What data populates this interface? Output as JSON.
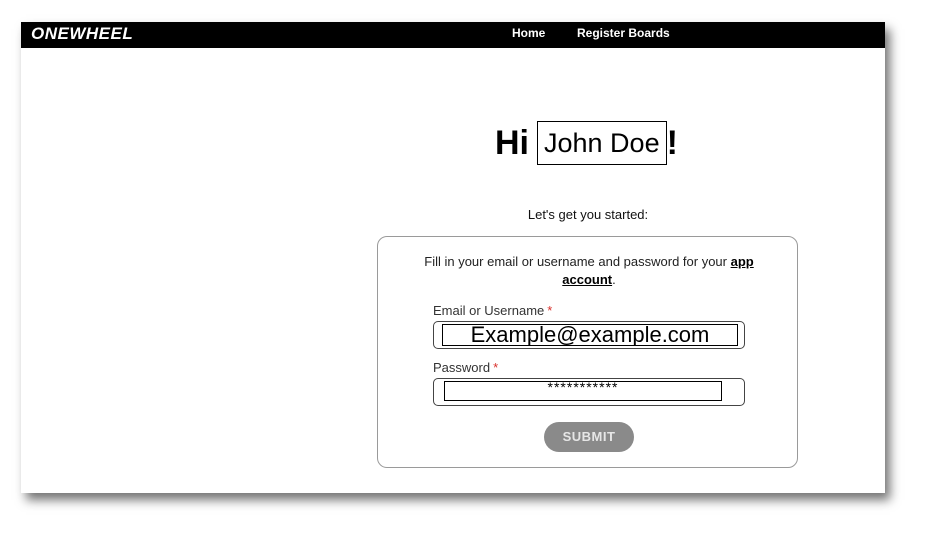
{
  "header": {
    "logo_text": "ONEWHEEL",
    "nav": [
      {
        "label": "Home"
      },
      {
        "label": "Register Boards"
      }
    ]
  },
  "greeting": {
    "prefix": "Hi",
    "name": "John Doe",
    "suffix": "!"
  },
  "subtitle": "Let's get you started:",
  "form": {
    "intro_before": "Fill in your email or username and password for your ",
    "intro_link": "app account",
    "intro_after": ".",
    "email_label": "Email or Username",
    "email_value": "Example@example.com",
    "password_label": "Password",
    "password_value": "***********",
    "required_mark": "*",
    "submit_label": "SUBMIT"
  },
  "colors": {
    "topbar": "#000000",
    "required": "#d9302b",
    "submit_bg": "#8a8a8a"
  }
}
